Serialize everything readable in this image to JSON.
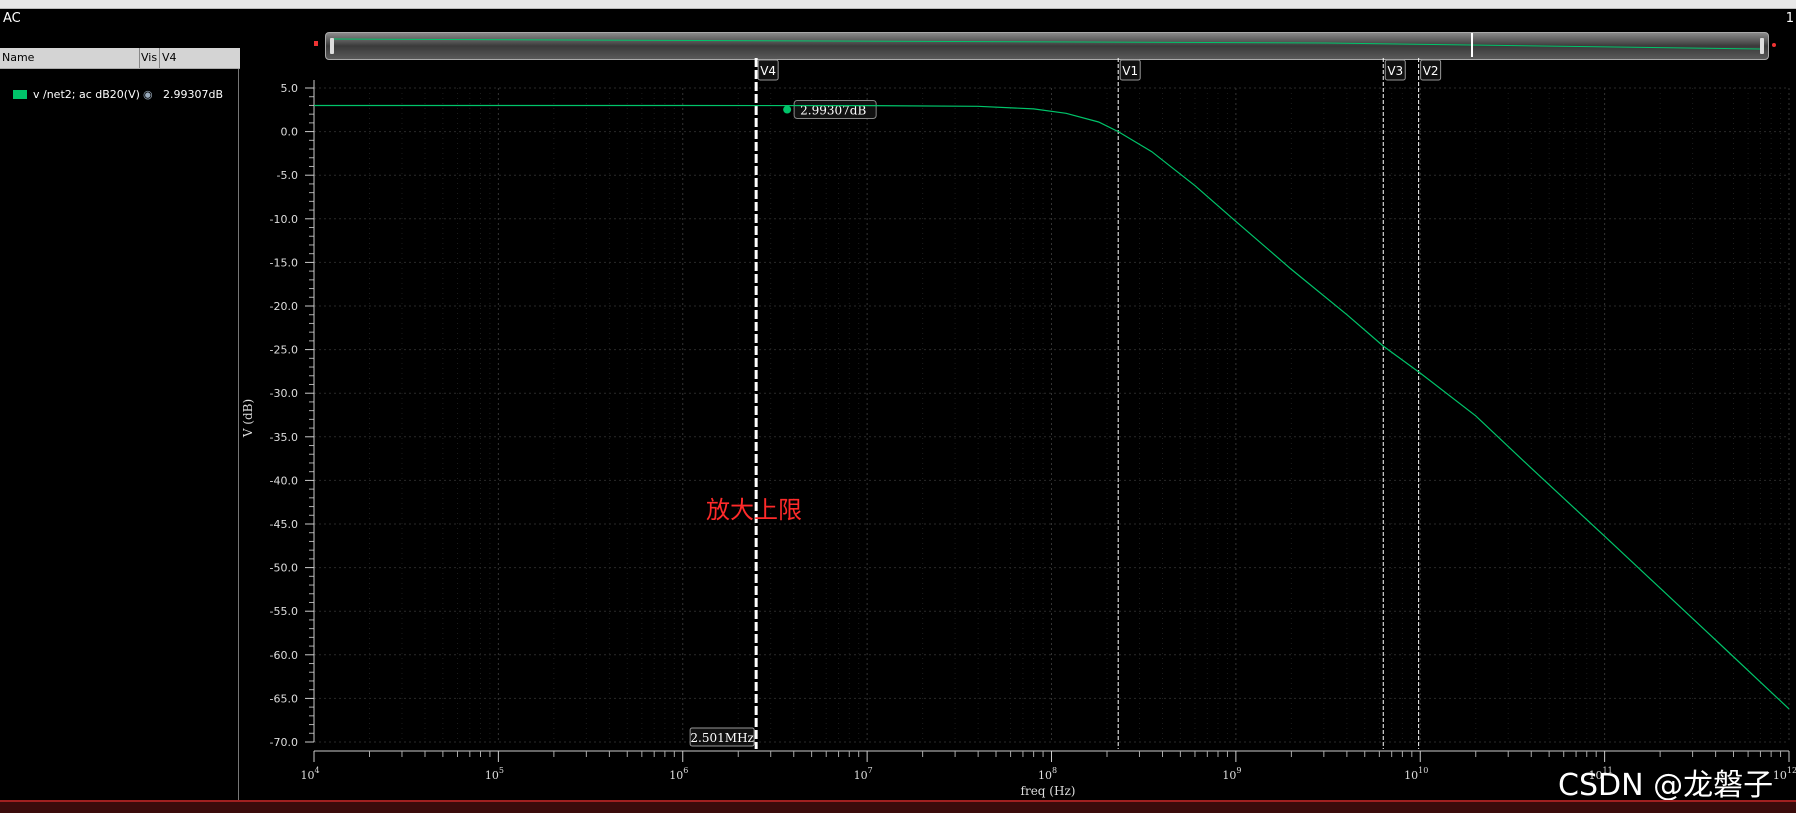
{
  "window": {
    "title": "AC",
    "right_label": "1"
  },
  "legend_panel": {
    "columns": [
      "Name",
      "Vis",
      "V4"
    ],
    "rows": [
      {
        "name": "v /net2; ac dB20(V)",
        "value": "2.99307dB",
        "color": "#00c46a",
        "visible_icon": "eye-icon"
      }
    ]
  },
  "markers": {
    "vertical": [
      {
        "label": "V4",
        "freq": 2501000,
        "style": "bold-dashed"
      },
      {
        "label": "V1",
        "freq": 230000000,
        "style": "dashed"
      },
      {
        "label": "V3",
        "freq": 6300000000,
        "style": "dashed"
      },
      {
        "label": "V2",
        "freq": 9800000000,
        "style": "dashed"
      }
    ],
    "point_label": "2.99307dB",
    "x_readout": "2.501MHz"
  },
  "annotation": "放大上限",
  "watermark": "CSDN @龙磐子",
  "chart_data": {
    "type": "line",
    "xscale": "log",
    "xlabel": "freq (Hz)",
    "ylabel": "V (dB)",
    "xlim": [
      10000,
      1000000000000
    ],
    "ylim": [
      -70,
      5
    ],
    "x_ticks": [
      {
        "exp": "4",
        "value": 10000
      },
      {
        "exp": "5",
        "value": 100000
      },
      {
        "exp": "6",
        "value": 1000000
      },
      {
        "exp": "7",
        "value": 10000000
      },
      {
        "exp": "8",
        "value": 100000000
      },
      {
        "exp": "9",
        "value": 1000000000
      },
      {
        "exp": "10",
        "value": 10000000000
      },
      {
        "exp": "11",
        "value": 100000000000
      },
      {
        "exp": "12",
        "value": 1000000000000
      }
    ],
    "y_ticks": [
      "5.0",
      "0.0",
      "-5.0",
      "-10.0",
      "-15.0",
      "-20.0",
      "-25.0",
      "-30.0",
      "-35.0",
      "-40.0",
      "-45.0",
      "-50.0",
      "-55.0",
      "-60.0",
      "-65.0",
      "-70.0"
    ],
    "grid": true,
    "series": [
      {
        "name": "v /net2; ac dB20(V)",
        "color": "#00c46a",
        "x": [
          10000,
          1000000,
          10000000,
          40000000,
          80000000,
          120000000,
          180000000,
          230000000,
          350000000,
          600000000,
          1000000000,
          2000000000,
          4000000000,
          6300000000,
          10000000000,
          20000000000,
          40000000000,
          100000000000,
          400000000000,
          1000000000000
        ],
        "y": [
          2.99,
          2.99,
          2.98,
          2.9,
          2.6,
          2.1,
          1.1,
          0.0,
          -2.3,
          -6.2,
          -10.3,
          -15.8,
          -21.0,
          -24.6,
          -27.7,
          -32.6,
          -38.6,
          -46.4,
          -58.3,
          -66.2
        ]
      }
    ]
  }
}
